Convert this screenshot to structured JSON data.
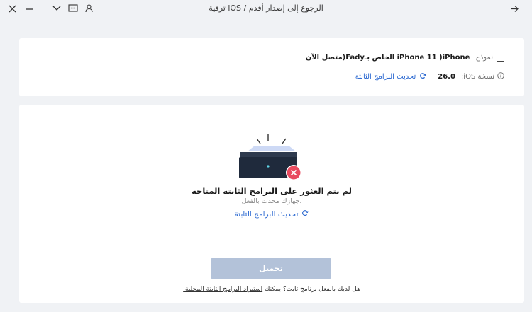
{
  "window": {
    "title": "ترقية iOS / الرجوع إلى إصدار أقدم",
    "icons": [
      "close-icon",
      "minimize-icon",
      "chevron-down-icon",
      "message-icon",
      "user-icon",
      "back-arrow-icon"
    ]
  },
  "device": {
    "model_label": "نموذج",
    "model_value": "iPhone 11 )iPhone الخاص بـFady(متصل الآن",
    "version_label": "نسخة iOS:",
    "version_value": "26.0",
    "update_firmware_link": "تحديث البرامج الثابتة"
  },
  "status": {
    "title": "لم يتم العثور على البرامج الثابتة المتاحة",
    "subtitle": "جهازك محدث بالفعل.",
    "update_link": "تحديث البرامج الثابتة"
  },
  "download_button": "تحميل",
  "footer": {
    "question": "هل لديك بالفعل برنامج ثابت؟ يمكنك",
    "link": "استيراد البرامج الثابتة المحلية."
  },
  "colors": {
    "accent": "#2d6ad1",
    "error": "#e84a5f",
    "disabled_button": "#b3c2d9",
    "background": "#f0f2f5"
  }
}
